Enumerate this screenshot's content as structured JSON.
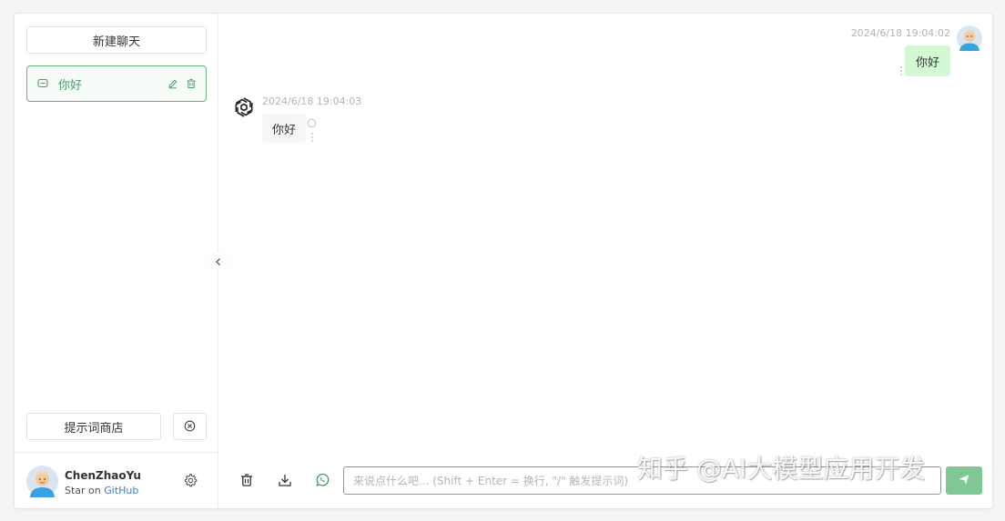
{
  "sidebar": {
    "new_chat_label": "新建聊天",
    "conversations": [
      {
        "title": "你好",
        "icon": "chat-bubble-icon",
        "actions": [
          "edit-icon",
          "trash-icon"
        ]
      }
    ],
    "prompt_store_label": "提示词商店",
    "clear_icon": "circle-x-icon",
    "user": {
      "name": "ChenZhaoYu",
      "sub_prefix": "Star on ",
      "sub_link": "GitHub"
    },
    "settings_icon": "gear-icon",
    "collapse_icon": "chevron-left-icon"
  },
  "chat": {
    "messages": [
      {
        "role": "user",
        "time": "2024/6/18 19:04:02",
        "text": "你好"
      },
      {
        "role": "assistant",
        "time": "2024/6/18 19:04:03",
        "text": "你好"
      }
    ]
  },
  "input": {
    "placeholder": "来说点什么吧... (Shift + Enter = 换行, \"/\" 触发提示词)",
    "value": "",
    "tools": [
      "trash-icon",
      "download-icon",
      "whatsapp-icon"
    ],
    "send_icon": "send-icon"
  },
  "watermark": "知乎 @AI大模型应用开发",
  "colors": {
    "accent": "#67b07f",
    "user_bubble": "#d2f9d1",
    "bot_bubble": "#f4f6f8",
    "link": "#3c7fd4"
  }
}
